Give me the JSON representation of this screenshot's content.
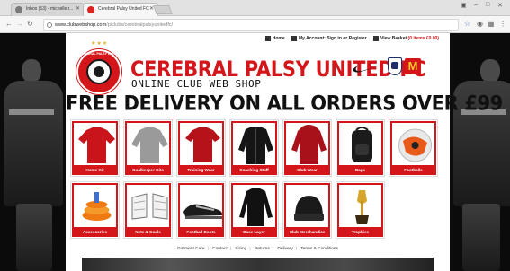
{
  "browser": {
    "tabs": [
      {
        "title": "Inbox (53) - michelle.r..."
      },
      {
        "title": "Cerebral Palsy United FC"
      }
    ],
    "url_host": "www.clubwebshop.com",
    "url_path": "/p/clubs/cerebralpalsyunitedfc/"
  },
  "header": {
    "nav": {
      "home": "Home",
      "account": "My Account: Sign in or Register",
      "basket": "View Basket",
      "basket_count": "(0 items £0.00)"
    },
    "crest_text": "CEREBRAL PALSY UNITED",
    "stars": "★★★",
    "title": "CEREBRAL PALSY UNITED FC",
    "subtitle": "ONLINE CLUB WEB SHOP",
    "sponsor_letter": "M"
  },
  "banner": "FREE DELIVERY ON ALL ORDERS OVER £99",
  "categories": [
    {
      "label": "Home Kit",
      "icon": "red-shirt-icon"
    },
    {
      "label": "Goalkeeper Kits",
      "icon": "grey-shirt-icon"
    },
    {
      "label": "Training Wear",
      "icon": "red-training-shirt-icon"
    },
    {
      "label": "Coaching Staff",
      "icon": "black-jacket-icon"
    },
    {
      "label": "Club Wear",
      "icon": "red-hoodie-icon"
    },
    {
      "label": "Bags",
      "icon": "backpack-icon"
    },
    {
      "label": "Footballs",
      "icon": "football-icon"
    },
    {
      "label": "Accessories",
      "icon": "training-cones-icon"
    },
    {
      "label": "Nets & Goals",
      "icon": "goal-net-icon"
    },
    {
      "label": "Football Boots",
      "icon": "boots-icon"
    },
    {
      "label": "Base Layer",
      "icon": "base-layer-icon"
    },
    {
      "label": "Club Merchandise",
      "icon": "beanie-icon"
    },
    {
      "label": "Trophies",
      "icon": "trophy-icon"
    }
  ],
  "footer": {
    "links": [
      "Garment Care",
      "Contact",
      "Sizing",
      "Returns",
      "Delivery",
      "Terms & Conditions"
    ]
  },
  "colors": {
    "brand_red": "#d4161b",
    "page_bg": "#0b0b0b"
  }
}
